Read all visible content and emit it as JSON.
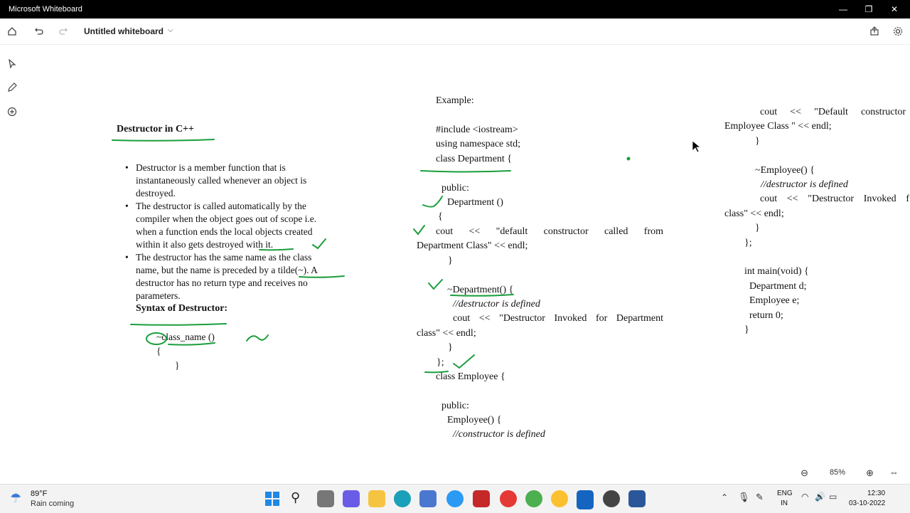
{
  "window": {
    "title": "Microsoft Whiteboard",
    "minimize": "—",
    "maximize": "❐",
    "close": "✕"
  },
  "toolbar": {
    "doc_title": "Untitled whiteboard",
    "chevron": "⌵"
  },
  "content": {
    "left": {
      "heading": "Destructor in C++",
      "bullets": [
        [
          "Destructor is a member function that is",
          "instantaneously called whenever an object is",
          "destroyed."
        ],
        [
          "The destructor is called automatically by the",
          "compiler when the object goes out of scope i.e.",
          "when a function ends the local objects created",
          "within it also gets destroyed with it."
        ],
        [
          "The destructor has the same name as the class",
          "name, but the name is preceded by a tilde(~). A",
          "destructor has no return type and receives no",
          "parameters."
        ]
      ],
      "syntax_heading": "Syntax of Destructor:",
      "syntax_lines": [
        "~class_name ()",
        "{",
        "}"
      ]
    },
    "middle": {
      "lines": [
        "Example:",
        "#include <iostream>",
        "using namespace std;",
        "class Department {",
        "public:",
        "Department ()",
        "{",
        "cout << \"default constructor called from",
        "Department Class\" << endl;",
        "}",
        "~Department() {",
        "//destructor is defined",
        "cout << \"Destructor Invoked for Department",
        "class\" << endl;",
        "}",
        "};",
        "class Employee {",
        "public:",
        "Employee() {",
        "//constructor is defined"
      ]
    },
    "right": {
      "lines": [
        "cout << \"Default constructor",
        "Employee Class \" << endl;",
        "}",
        "~Employee() {",
        "//destructor is defined",
        "cout << \"Destructor Invoked f",
        "class\" << endl;",
        "}",
        "};",
        "int main(void) {",
        "Department d;",
        "Employee e;",
        "return 0;",
        "}"
      ]
    }
  },
  "zoom": {
    "level": "85%"
  },
  "taskbar": {
    "weather_temp": "89°F",
    "weather_text": "Rain coming",
    "lang_top": "ENG",
    "lang_bottom": "IN",
    "time": "12:30",
    "date": "03-10-2022"
  },
  "colors": {
    "ink": "#1a9e3c",
    "titlebar": "#000000",
    "taskbar": "#f3f3f3"
  }
}
